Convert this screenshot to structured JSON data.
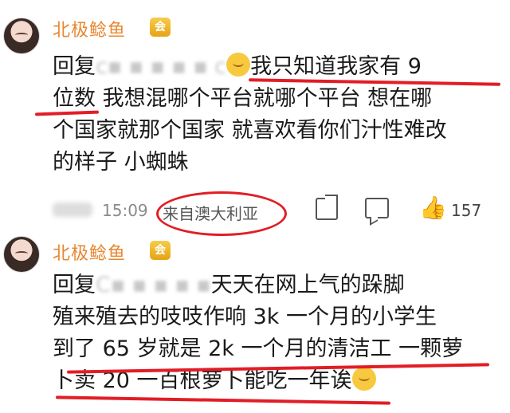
{
  "comment1": {
    "username": "北极鲶鱼",
    "badge": "会",
    "reply_prefix": "回复",
    "blurred_name": "c▪ ▪ ▪ ▪ ▪ c",
    "line1_text": "我只知道我家有 9",
    "line2": "位数 我想混哪个平台就哪个平台 想在哪",
    "line3": "个国家就那个国家 就喜欢看你们汁性难改",
    "line4": "的样子 小蜘蛛",
    "time": "15:09",
    "location": "来自澳大利亚",
    "like_count": "157"
  },
  "comment2": {
    "username": "北极鲶鱼",
    "badge": "会",
    "reply_prefix": "回复",
    "blurred_name": "C▪ ▪ ▪ ▪ ▪",
    "line1_text": "天天在网上气的跺脚",
    "line2": "殖来殖去的吱吱作响 3k 一个月的小学生",
    "line3": "到了 65 岁就是 2k 一个月的清洁工 一颗萝",
    "line4": "卜卖 20 一百根萝卜能吃一年诶"
  },
  "icons": {
    "share": "share-icon",
    "comment": "comment-icon",
    "like": "like-icon"
  },
  "colors": {
    "username": "#e8872f",
    "annotation_red": "#e21d26",
    "meta_gray": "#8a8a8a"
  }
}
